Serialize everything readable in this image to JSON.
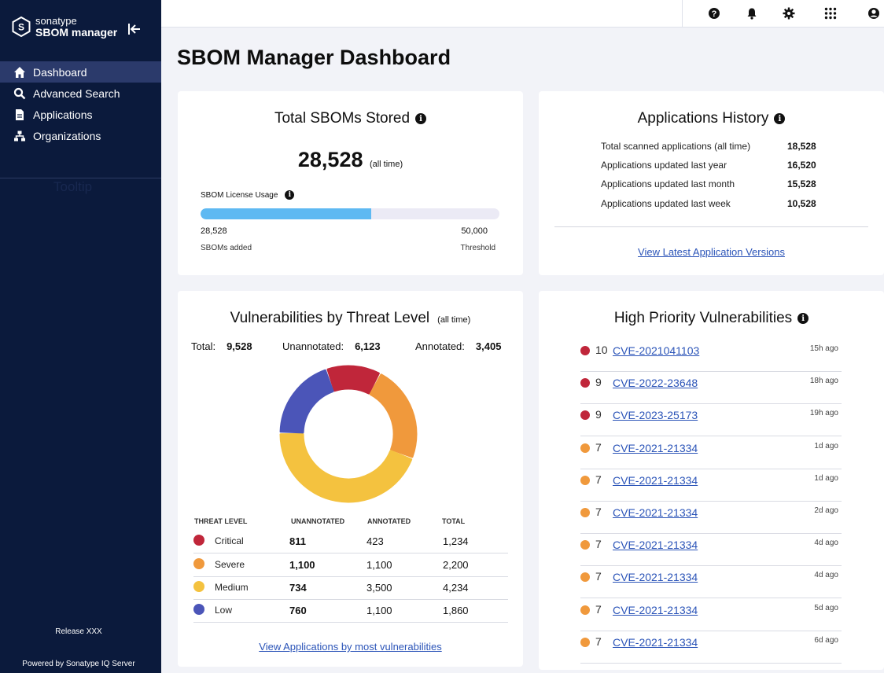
{
  "brand": {
    "line1": "sonatype",
    "line2": "SBOM manager"
  },
  "sidebar": {
    "items": [
      {
        "label": "Dashboard",
        "icon": "home-icon",
        "active": true
      },
      {
        "label": "Advanced Search",
        "icon": "search-icon",
        "active": false
      },
      {
        "label": "Applications",
        "icon": "document-icon",
        "active": false
      },
      {
        "label": "Organizations",
        "icon": "org-tree-icon",
        "active": false
      }
    ],
    "ghost_text": "Tooltip",
    "release": "Release XXX",
    "powered_by": "Powered by Sonatype IQ Server"
  },
  "topbar": {
    "icons": [
      "help-icon",
      "bell-icon",
      "gear-icon",
      "apps-grid-icon",
      "user-icon"
    ]
  },
  "page": {
    "title": "SBOM Manager Dashboard"
  },
  "total_sboms": {
    "title": "Total SBOMs Stored",
    "count": "28,528",
    "count_suffix": "(all time)",
    "license_label": "SBOM License Usage",
    "usage_fraction": 0.5706,
    "added_value": "28,528",
    "added_caption": "SBOMs added",
    "threshold_value": "50,000",
    "threshold_caption": "Threshold"
  },
  "app_history": {
    "title": "Applications History",
    "rows": [
      {
        "label": "Total scanned applications (all time)",
        "value": "18,528"
      },
      {
        "label": "Applications updated last year",
        "value": "16,520"
      },
      {
        "label": "Applications updated last month",
        "value": "15,528"
      },
      {
        "label": "Applications updated last week",
        "value": "10,528"
      }
    ],
    "link": "View Latest Application Versions"
  },
  "vulns": {
    "title": "Vulnerabilities by Threat Level",
    "title_suffix": "(all time)",
    "total_label": "Total:",
    "total": "9,528",
    "unannotated_label": "Unannotated:",
    "unannotated": "6,123",
    "annotated_label": "Annotated:",
    "annotated": "3,405",
    "columns": [
      "THREAT LEVEL",
      "UNANNOTATED",
      "ANNOTATED",
      "TOTAL"
    ],
    "rows": [
      {
        "level": "Critical",
        "unannotated": "811",
        "annotated": "423",
        "total": "1,234",
        "color": "#c0263a"
      },
      {
        "level": "Severe",
        "unannotated": "1,100",
        "annotated": "1,100",
        "total": "2,200",
        "color": "#f0993c"
      },
      {
        "level": "Medium",
        "unannotated": "734",
        "annotated": "3,500",
        "total": "4,234",
        "color": "#f4c23f"
      },
      {
        "level": "Low",
        "unannotated": "760",
        "annotated": "1,100",
        "total": "1,860",
        "color": "#4b55b8"
      }
    ],
    "link": "View Applications by most vulnerabilities"
  },
  "chart_data": {
    "type": "pie",
    "categories": [
      "Critical",
      "Severe",
      "Medium",
      "Low"
    ],
    "values": [
      1234,
      2200,
      4234,
      1860
    ],
    "colors": [
      "#c0263a",
      "#f0993c",
      "#f4c23f",
      "#4b55b8"
    ],
    "donut": true
  },
  "high_priority": {
    "title": "High Priority Vulnerabilities",
    "rows": [
      {
        "score": "10",
        "cve": "CVE-2021041103",
        "ago": "15h ago",
        "color": "#c0263a"
      },
      {
        "score": "9",
        "cve": "CVE-2022-23648",
        "ago": "18h ago",
        "color": "#c0263a"
      },
      {
        "score": "9",
        "cve": "CVE-2023-25173",
        "ago": "19h ago",
        "color": "#c0263a"
      },
      {
        "score": "7",
        "cve": "CVE-2021-21334",
        "ago": "1d ago",
        "color": "#f0993c"
      },
      {
        "score": "7",
        "cve": "CVE-2021-21334",
        "ago": "1d ago",
        "color": "#f0993c"
      },
      {
        "score": "7",
        "cve": "CVE-2021-21334",
        "ago": "2d ago",
        "color": "#f0993c"
      },
      {
        "score": "7",
        "cve": "CVE-2021-21334",
        "ago": "4d ago",
        "color": "#f0993c"
      },
      {
        "score": "7",
        "cve": "CVE-2021-21334",
        "ago": "4d ago",
        "color": "#f0993c"
      },
      {
        "score": "7",
        "cve": "CVE-2021-21334",
        "ago": "5d ago",
        "color": "#f0993c"
      },
      {
        "score": "7",
        "cve": "CVE-2021-21334",
        "ago": "6d ago",
        "color": "#f0993c"
      }
    ]
  }
}
